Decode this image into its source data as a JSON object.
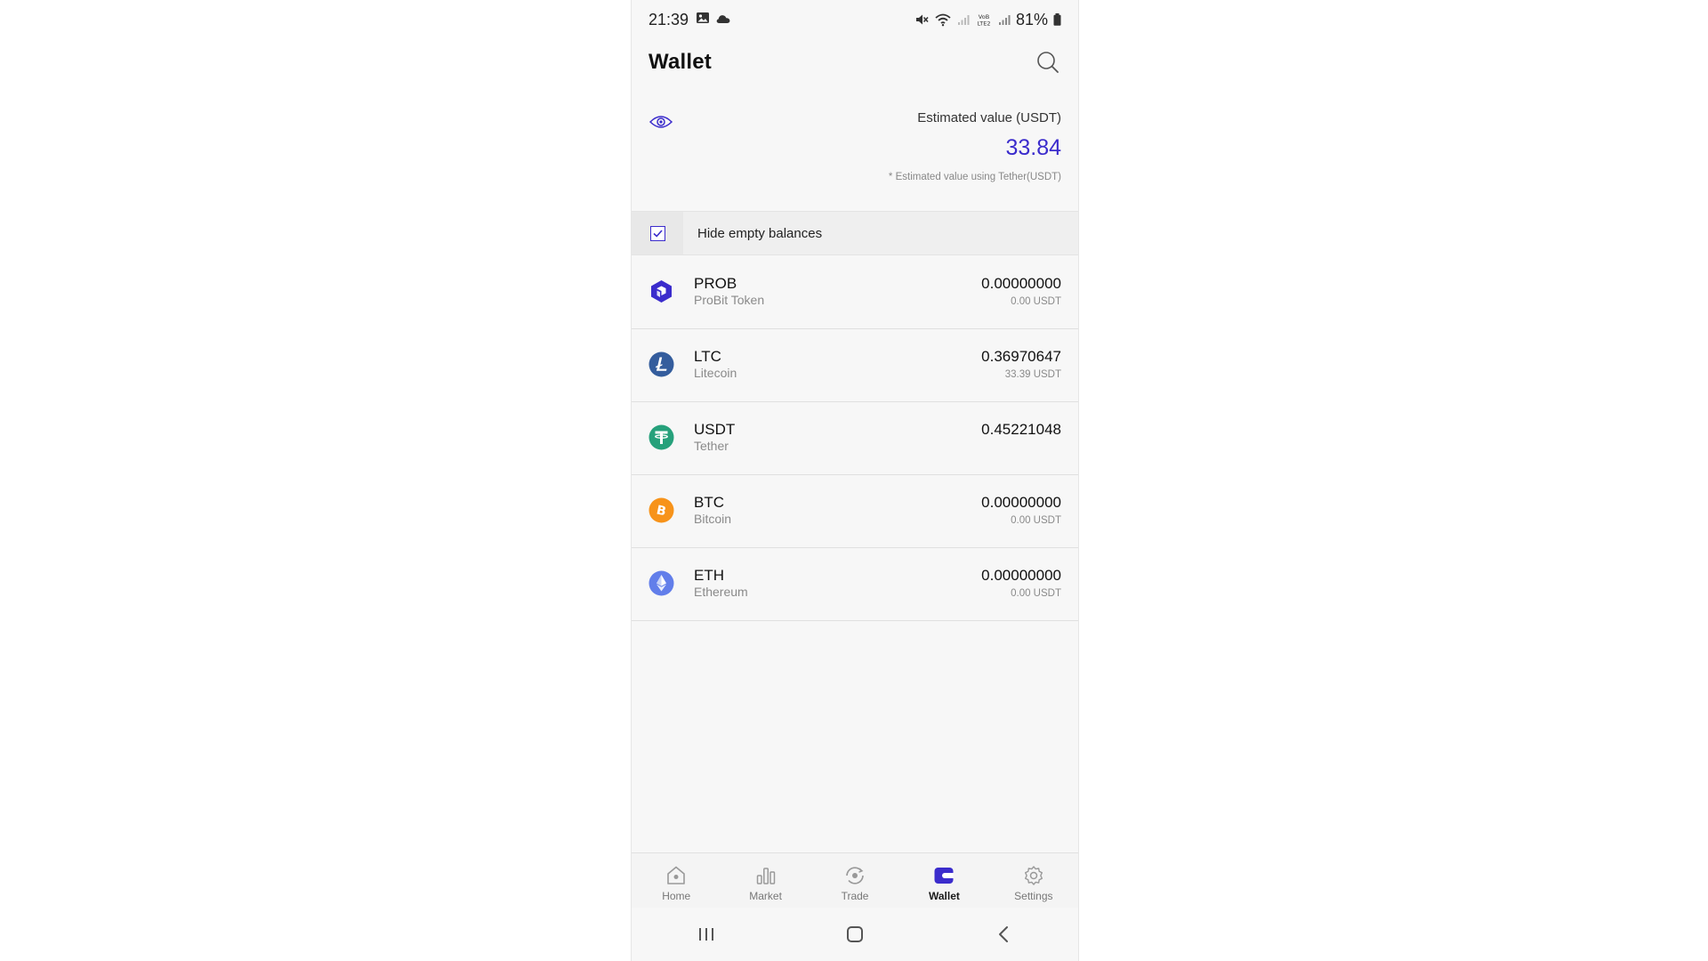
{
  "status_bar": {
    "time": "21:39",
    "battery": "81%",
    "icons": [
      "image-icon",
      "cloud-icon",
      "mute-icon",
      "wifi-icon",
      "signal-icon",
      "volte-icon",
      "signal-icon",
      "battery-icon"
    ],
    "volte_label": "VoB LTE2"
  },
  "header": {
    "title": "Wallet",
    "search_icon": "search-icon"
  },
  "estimate": {
    "label": "Estimated value (USDT)",
    "value": "33.84",
    "note": "* Estimated value using Tether(USDT)",
    "value_color": "#3b2ccc"
  },
  "hide_empty": {
    "label": "Hide empty balances",
    "checked": true
  },
  "assets": [
    {
      "symbol": "PROB",
      "name": "ProBit Token",
      "amount": "0.00000000",
      "usdt": "0.00 USDT",
      "icon": "probit-icon",
      "color": "#3b2ccc"
    },
    {
      "symbol": "LTC",
      "name": "Litecoin",
      "amount": "0.36970647",
      "usdt": "33.39 USDT",
      "icon": "litecoin-icon",
      "color": "#345d9d"
    },
    {
      "symbol": "USDT",
      "name": "Tether",
      "amount": "0.45221048",
      "usdt": "",
      "icon": "tether-icon",
      "color": "#26a17b"
    },
    {
      "symbol": "BTC",
      "name": "Bitcoin",
      "amount": "0.00000000",
      "usdt": "0.00 USDT",
      "icon": "bitcoin-icon",
      "color": "#f7931a"
    },
    {
      "symbol": "ETH",
      "name": "Ethereum",
      "amount": "0.00000000",
      "usdt": "0.00 USDT",
      "icon": "ethereum-icon",
      "color": "#627eea"
    }
  ],
  "bottom_nav": [
    {
      "label": "Home",
      "icon": "home-icon",
      "active": false
    },
    {
      "label": "Market",
      "icon": "market-icon",
      "active": false
    },
    {
      "label": "Trade",
      "icon": "trade-icon",
      "active": false
    },
    {
      "label": "Wallet",
      "icon": "wallet-icon",
      "active": true
    },
    {
      "label": "Settings",
      "icon": "settings-icon",
      "active": false
    }
  ],
  "android_nav": [
    "recents-icon",
    "home-button-icon",
    "back-icon"
  ],
  "accent_color": "#3b2ccc"
}
